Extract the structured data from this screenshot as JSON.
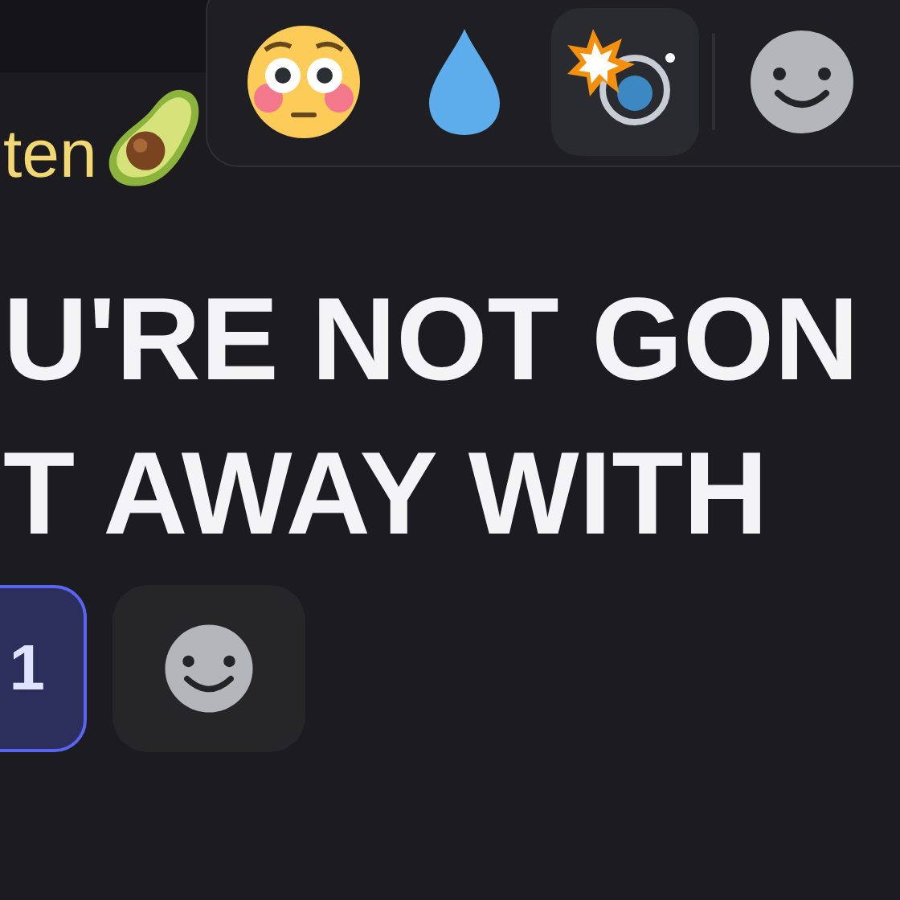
{
  "message": {
    "author": "ten",
    "lines": [
      "U'RE NOT GON",
      "T AWAY WITH"
    ]
  },
  "hover_toolbar": {
    "items": [
      {
        "kind": "flushed",
        "selected": false
      },
      {
        "kind": "droplet",
        "selected": false
      },
      {
        "kind": "camera",
        "selected": true
      },
      {
        "kind": "add-reaction",
        "selected": false
      }
    ]
  },
  "reactions": [
    {
      "count": "1",
      "selected": true
    }
  ]
}
